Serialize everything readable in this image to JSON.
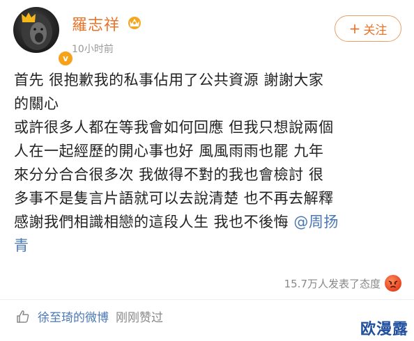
{
  "header": {
    "username": "羅志祥",
    "time": "10小时前",
    "follow_label": "关注",
    "follow_plus": "+"
  },
  "post": {
    "lines": [
      "首先 很抱歉我的私事佔用了公共資源 謝謝大家",
      "的關心",
      "或許很多人都在等我會如何回應 但我只想說兩個",
      "人在一起經歷的開心事也好 風風雨雨也罷 九年",
      "來分分合合很多次 我做得不對的我也會檢討 很",
      "多事不是隻言片語就可以去說清楚 也不再去解釋",
      "感謝我們相識相戀的這段人生 我也不後悔 "
    ],
    "mention": "@周扬",
    "last_line": "青"
  },
  "reaction": {
    "text": "15.7万人发表了态度"
  },
  "liked": {
    "user": "徐至琦的微博",
    "action": "刚刚赞过"
  },
  "watermark": "欧漫露",
  "colors": {
    "name": "#e8742a",
    "link": "#4a78b5",
    "muted": "#999999"
  }
}
